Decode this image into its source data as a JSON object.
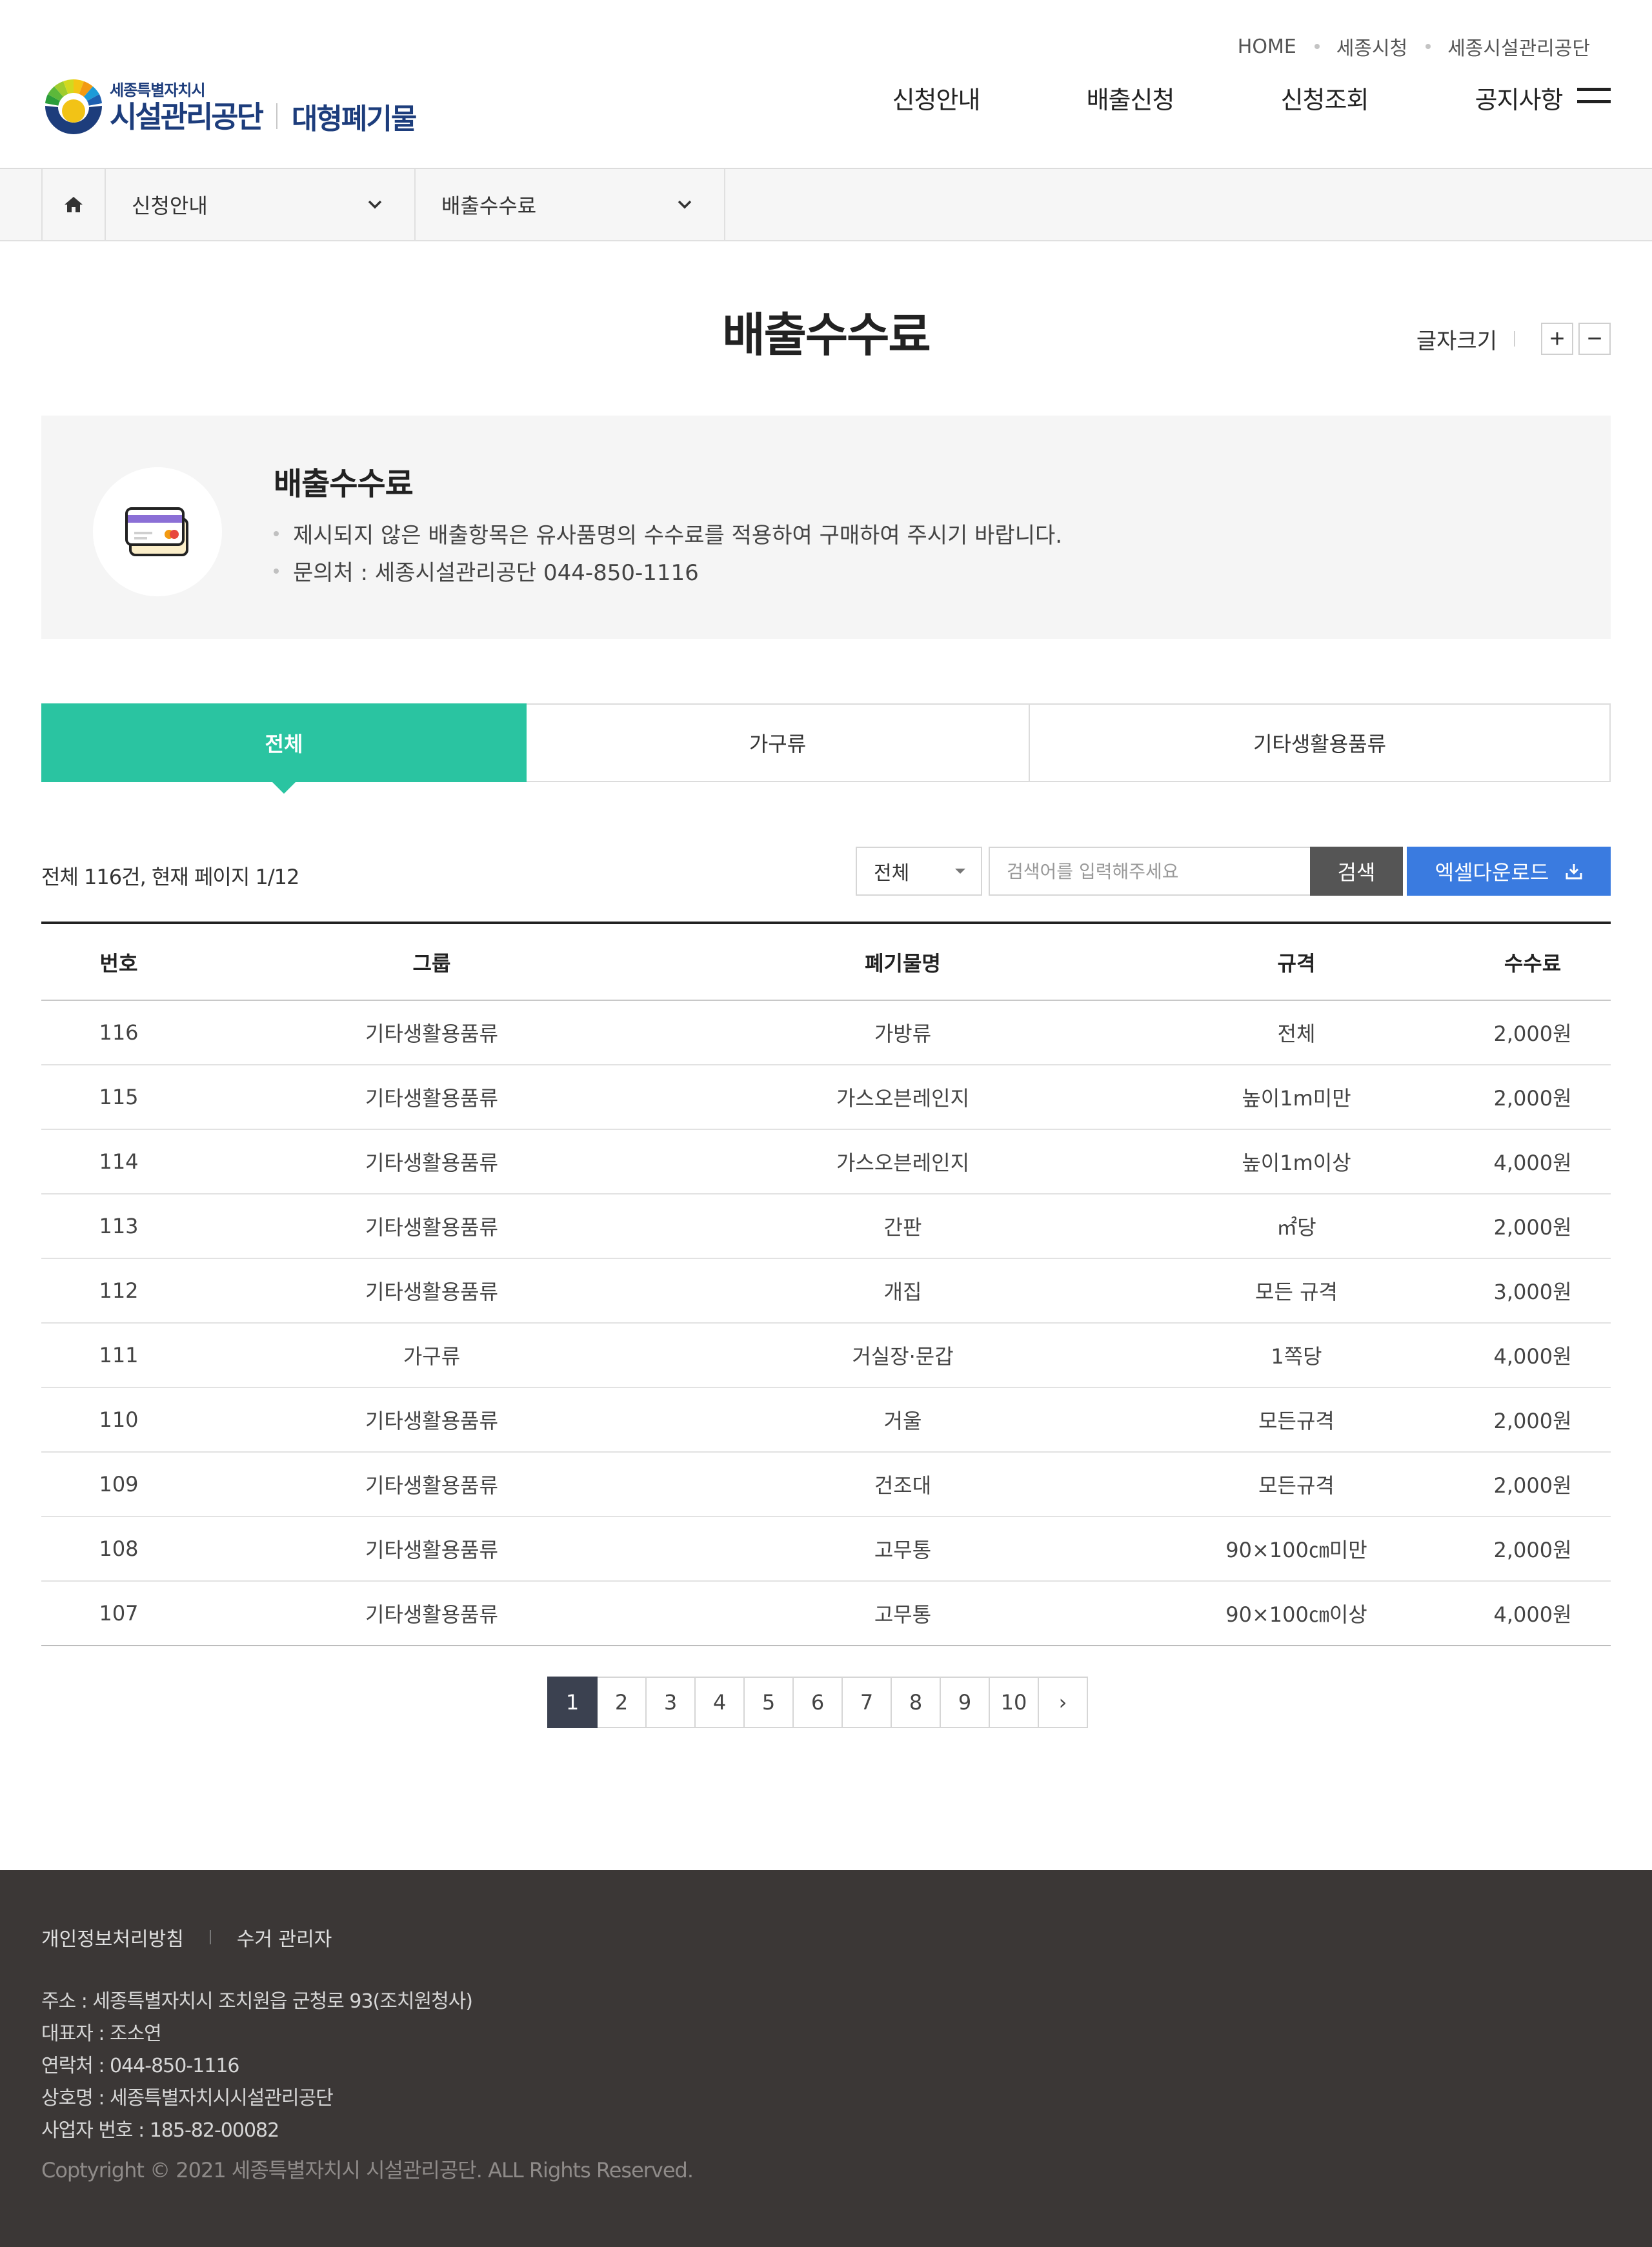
{
  "header": {
    "util_links": [
      "HOME",
      "세종시청",
      "세종시설관리공단"
    ],
    "logo": {
      "sub": "세종특별자치시",
      "main": "시설관리공단",
      "service": "대형폐기물"
    },
    "gnb": [
      "신청안내",
      "배출신청",
      "신청조회",
      "공지사항"
    ],
    "menu_icon": "hamburger-icon"
  },
  "location": {
    "home_icon": "home-icon",
    "depth1": "신청안내",
    "depth2": "배출수수료"
  },
  "page": {
    "title": "배출수수료",
    "font_size_label": "글자크기",
    "font_plus": "+",
    "font_minus": "−"
  },
  "info": {
    "icon": "card-icon",
    "title": "배출수수료",
    "items": [
      "제시되지 않은 배출항목은 유사품명의 수수료를 적용하여 구매하여 주시기 바랍니다.",
      "문의처 : 세종시설관리공단 044-850-1116"
    ]
  },
  "tabs": [
    "전체",
    "가구류",
    "기타생활용품류"
  ],
  "search": {
    "total_text": "전체 116건, 현재 페이지 1/12",
    "select_value": "전체",
    "placeholder": "검색어를 입력해주세요",
    "search_label": "검색",
    "excel_label": "엑셀다운로드"
  },
  "table": {
    "headers": [
      "번호",
      "그룹",
      "폐기물명",
      "규격",
      "수수료"
    ],
    "rows": [
      [
        "116",
        "기타생활용품류",
        "가방류",
        "전체",
        "2,000원"
      ],
      [
        "115",
        "기타생활용품류",
        "가스오븐레인지",
        "높이1m미만",
        "2,000원"
      ],
      [
        "114",
        "기타생활용품류",
        "가스오븐레인지",
        "높이1m이상",
        "4,000원"
      ],
      [
        "113",
        "기타생활용품류",
        "간판",
        "㎡당",
        "2,000원"
      ],
      [
        "112",
        "기타생활용품류",
        "개집",
        "모든 규격",
        "3,000원"
      ],
      [
        "111",
        "가구류",
        "거실장·문갑",
        "1쪽당",
        "4,000원"
      ],
      [
        "110",
        "기타생활용품류",
        "거울",
        "모든규격",
        "2,000원"
      ],
      [
        "109",
        "기타생활용품류",
        "건조대",
        "모든규격",
        "2,000원"
      ],
      [
        "108",
        "기타생활용품류",
        "고무통",
        "90×100㎝미만",
        "2,000원"
      ],
      [
        "107",
        "기타생활용품류",
        "고무통",
        "90×100㎝이상",
        "4,000원"
      ]
    ]
  },
  "pagination": {
    "pages": [
      "1",
      "2",
      "3",
      "4",
      "5",
      "6",
      "7",
      "8",
      "9",
      "10"
    ],
    "current": "1",
    "next": "›"
  },
  "footer": {
    "links": [
      "개인정보처리방침",
      "수거 관리자"
    ],
    "lines": [
      "주소 : 세종특별자치시 조치원읍 군청로 93(조치원청사)",
      "대표자 : 조소연",
      "연락처 : 044-850-1116",
      "상호명 : 세종특별자치시시설관리공단",
      "사업자 번호 : 185-82-00082"
    ],
    "copyright": "Coptyright © 2021 세종특별자치시 시설관리공단. ALL Rights Reserved."
  },
  "colors": {
    "accent_green": "#2ac4a1",
    "excel_blue": "#3a7be0",
    "brand_navy": "#1d3d7c",
    "footer_bg": "#3b3736",
    "page_active": "#3b4150"
  }
}
